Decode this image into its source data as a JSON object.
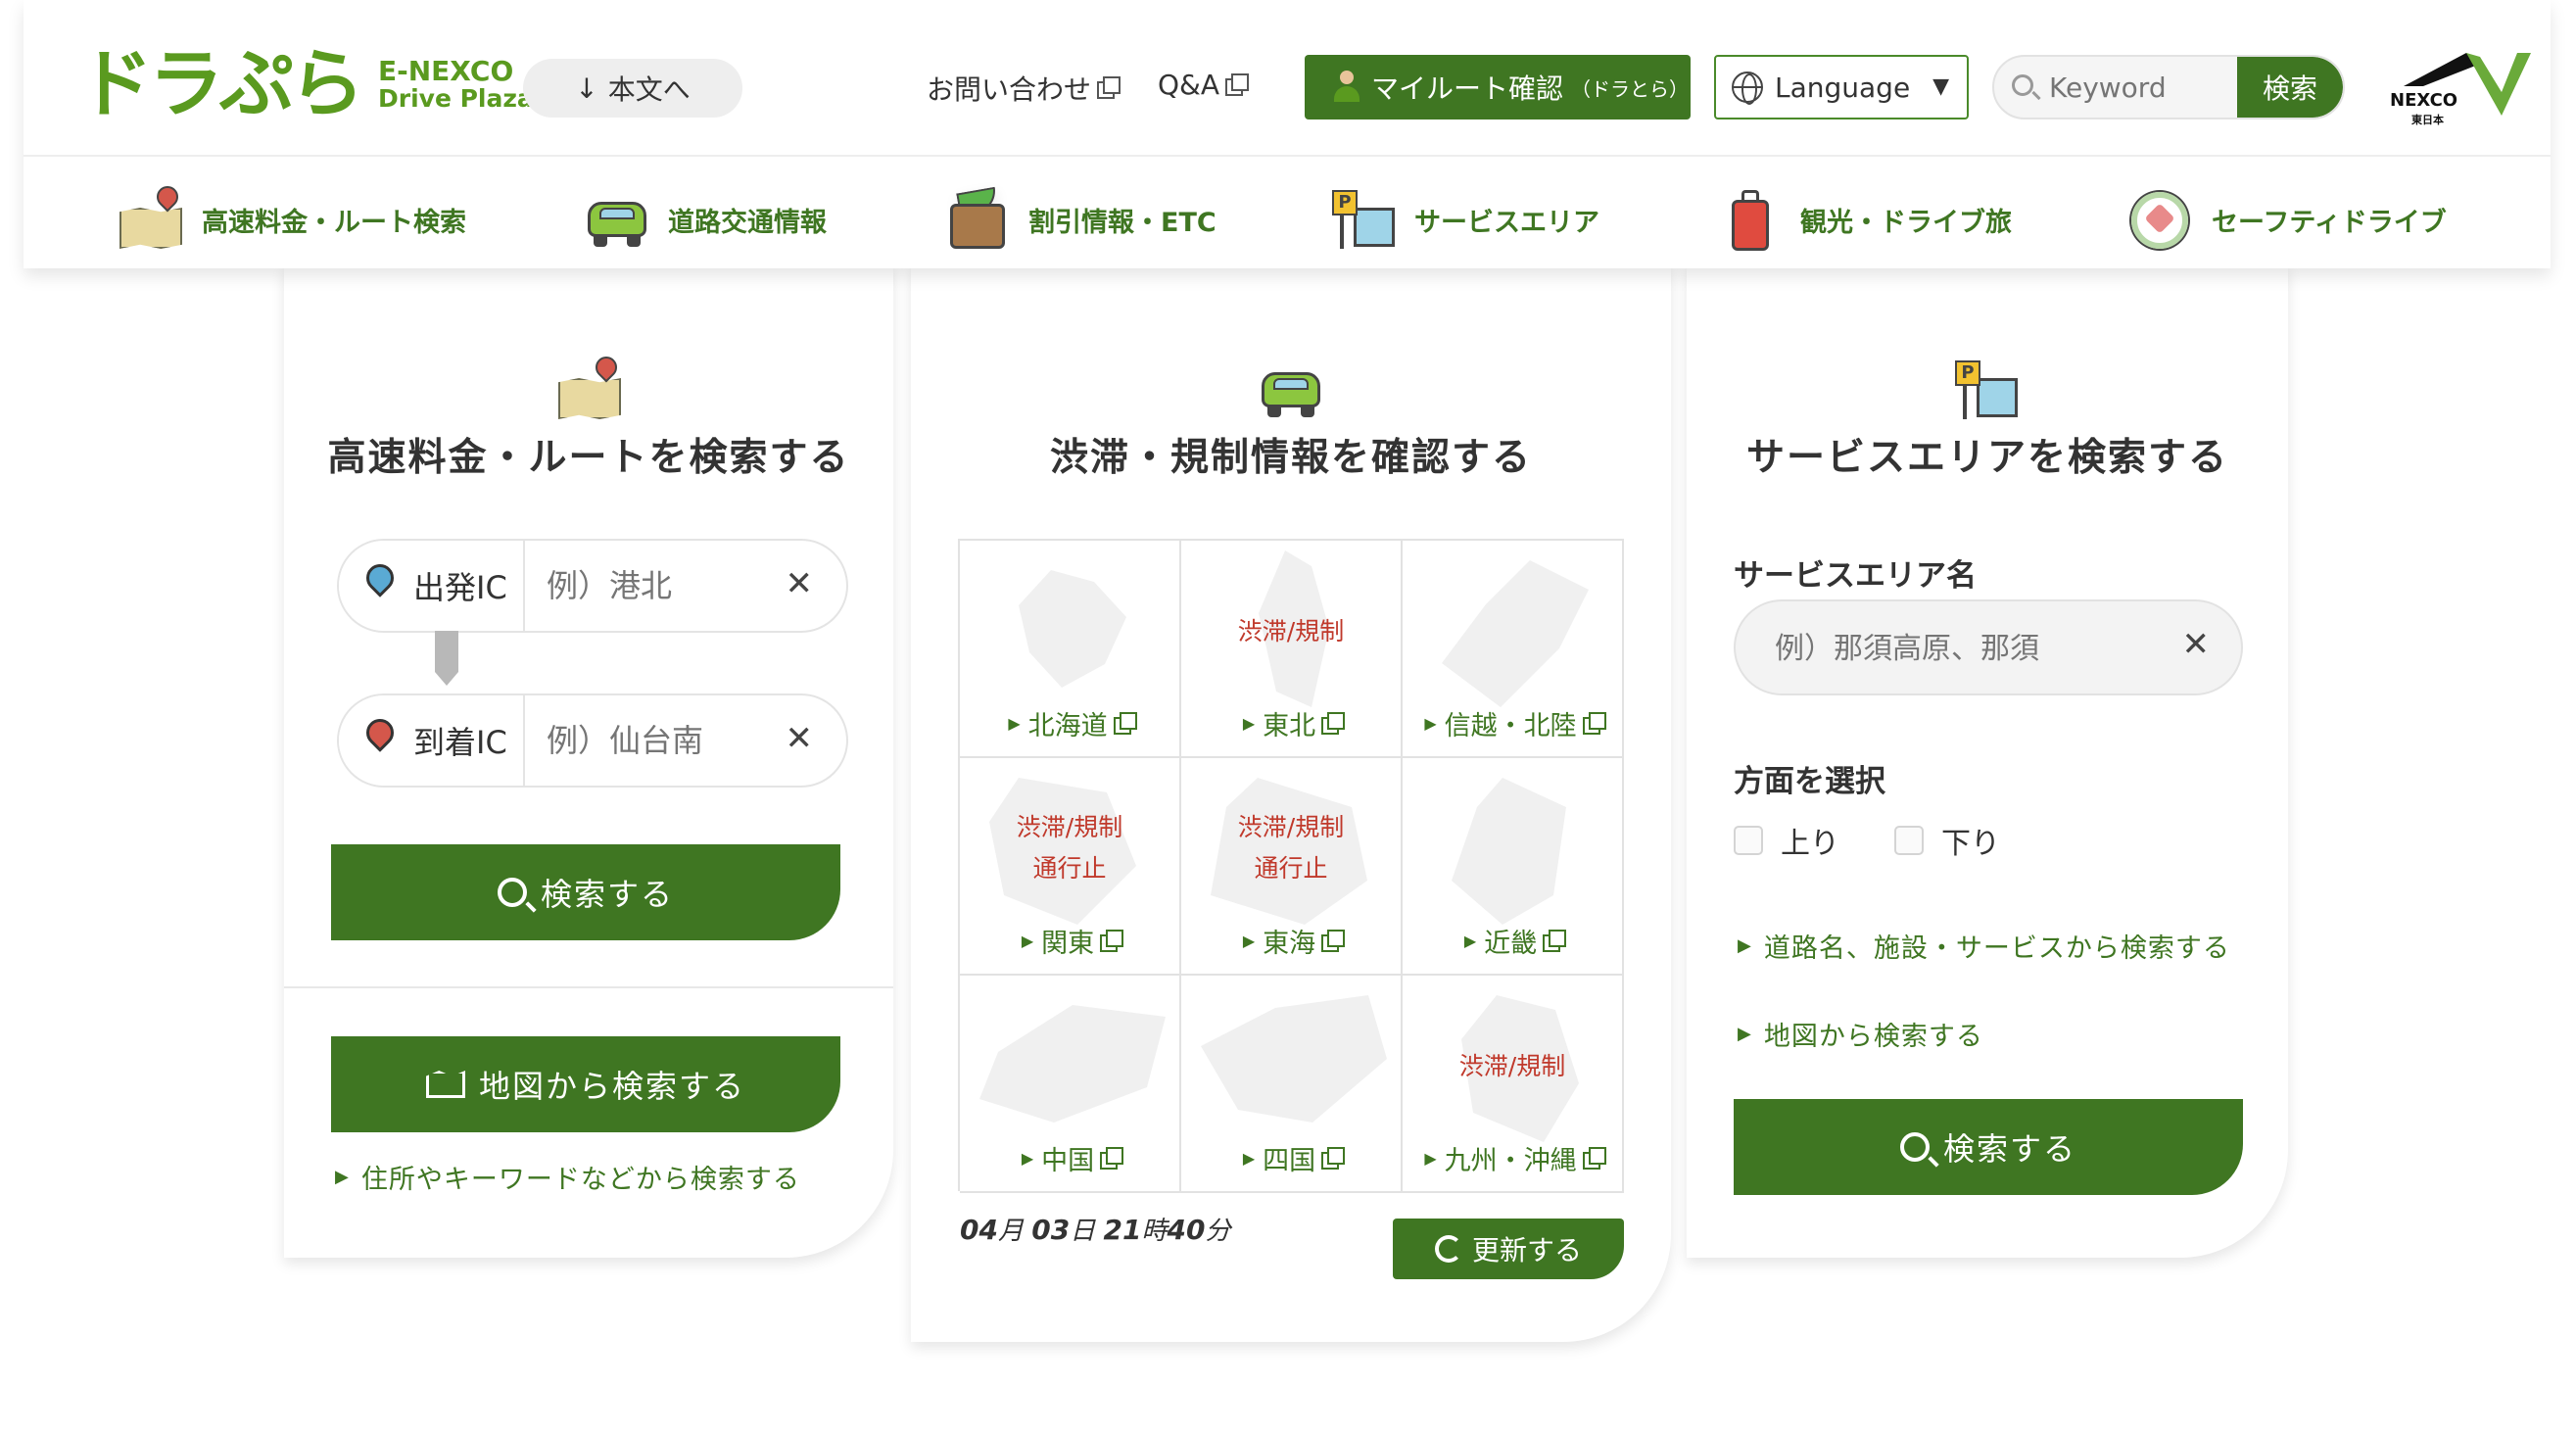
{
  "header": {
    "logo_main": "ドラぷら",
    "logo_sub1": "E-NEXCO",
    "logo_sub2": "Drive Plaza",
    "skip_label": "本文へ",
    "contact_label": "お問い合わせ",
    "qa_label": "Q&A",
    "myroute_label": "マイルート確認",
    "myroute_small": "（ドラとら）",
    "language_label": "Language",
    "search_placeholder": "Keyword",
    "search_button": "検索",
    "nexco_label": "NEXCO",
    "nexco_sub": "東日本"
  },
  "nav": [
    {
      "label": "高速料金・ルート検索",
      "icon": "map-icon"
    },
    {
      "label": "道路交通情報",
      "icon": "car-icon"
    },
    {
      "label": "割引情報・ETC",
      "icon": "wallet-icon"
    },
    {
      "label": "サービスエリア",
      "icon": "parking-area-icon"
    },
    {
      "label": "観光・ドライブ旅",
      "icon": "suitcase-icon"
    },
    {
      "label": "セーフティドライブ",
      "icon": "steering-wheel-icon"
    }
  ],
  "route": {
    "title": "高速料金・ルートを検索する",
    "depart_label": "出発IC",
    "depart_placeholder": "例）港北",
    "arrive_label": "到着IC",
    "arrive_placeholder": "例）仙台南",
    "search_button": "検索する",
    "map_button": "地図から検索する",
    "address_link": "住所やキーワードなどから検索する"
  },
  "traffic": {
    "title": "渋滞・規制情報を確認する",
    "regions": [
      {
        "name": "北海道",
        "status": []
      },
      {
        "name": "東北",
        "status": [
          "渋滞/規制"
        ]
      },
      {
        "name": "信越・北陸",
        "status": []
      },
      {
        "name": "関東",
        "status": [
          "渋滞/規制",
          "通行止"
        ]
      },
      {
        "name": "東海",
        "status": [
          "渋滞/規制",
          "通行止"
        ]
      },
      {
        "name": "近畿",
        "status": []
      },
      {
        "name": "中国",
        "status": []
      },
      {
        "name": "四国",
        "status": []
      },
      {
        "name": "九州・沖縄",
        "status": [
          "渋滞/規制"
        ]
      }
    ],
    "month": "04",
    "month_unit": "月",
    "day": "03",
    "day_unit": "日",
    "hour": "21",
    "hour_unit": "時",
    "minute": "40",
    "minute_unit": "分",
    "refresh_button": "更新する"
  },
  "sa": {
    "title": "サービスエリアを検索する",
    "name_label": "サービスエリア名",
    "name_placeholder": "例）那須高原、那須",
    "direction_label": "方面を選択",
    "up_label": "上り",
    "down_label": "下り",
    "road_link": "道路名、施設・サービスから検索する",
    "map_link": "地図から検索する",
    "search_button": "検索する"
  },
  "colors": {
    "brand_green": "#3f7622",
    "logo_green": "#5a9a1f",
    "alert_red": "#c0392b"
  }
}
